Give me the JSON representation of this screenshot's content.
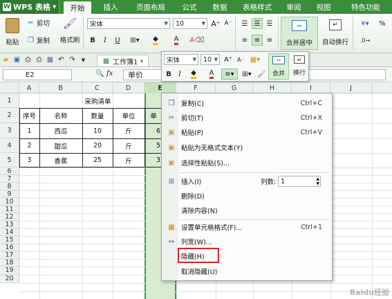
{
  "app": {
    "name": "WPS 表格",
    "logo_glyph": "W"
  },
  "menu_tabs": [
    "开始",
    "插入",
    "页面布局",
    "公式",
    "数据",
    "表格样式",
    "审阅",
    "视图",
    "特色功能"
  ],
  "ribbon": {
    "paste": "粘贴",
    "cut": "剪切",
    "copy": "复制",
    "format_painter": "格式刷",
    "font": "宋体",
    "font_size": "10",
    "merge_center": "合并居中",
    "wrap_text": "自动换行",
    "percent": "%"
  },
  "workbook_tab": "工作簿1 *",
  "formula_bar": {
    "cell_ref": "E2",
    "fx": "fx",
    "value": "单价"
  },
  "columns": [
    "A",
    "B",
    "C",
    "D",
    "E",
    "F",
    "G",
    "H",
    "I",
    "J"
  ],
  "rows": [
    "1",
    "2",
    "3",
    "4",
    "5",
    "6",
    "7",
    "8",
    "9",
    "10",
    "11",
    "12",
    "13",
    "14",
    "15",
    "16",
    "17",
    "18",
    "19",
    "20"
  ],
  "sheet": {
    "title": "采购清单",
    "headers": [
      "序号",
      "名称",
      "数量",
      "单位",
      "单"
    ],
    "data": [
      [
        "1",
        "西瓜",
        "10",
        "斤",
        "6"
      ],
      [
        "2",
        "甜瓜",
        "20",
        "斤",
        "5"
      ],
      [
        "3",
        "香蕉",
        "25",
        "斤",
        "3"
      ]
    ]
  },
  "float_toolbar": {
    "font": "宋体",
    "size": "10",
    "merge": "合并",
    "wrap": "换行"
  },
  "context_menu": {
    "copy": "复制(C)",
    "copy_key": "Ctrl+C",
    "cut": "剪切(T)",
    "cut_key": "Ctrl+X",
    "paste": "粘贴(P)",
    "paste_key": "Ctrl+V",
    "paste_plain": "粘贴为无格式文本(Y)",
    "paste_special": "选择性粘贴(S)...",
    "insert": "插入(I)",
    "col_count_label": "列数:",
    "col_count_value": "1",
    "delete": "删除(D)",
    "clear": "清除内容(N)",
    "format_cells": "设置单元格格式(F)...",
    "format_key": "Ctrl+1",
    "col_width": "列宽(W)...",
    "hide": "隐藏(H)",
    "unhide": "取消隐藏(U)"
  },
  "watermark": "Baidu经验",
  "colors": {
    "accent": "#3a8d3a",
    "highlight_box": "#e02020",
    "selected_col": "#d7ecd1"
  }
}
